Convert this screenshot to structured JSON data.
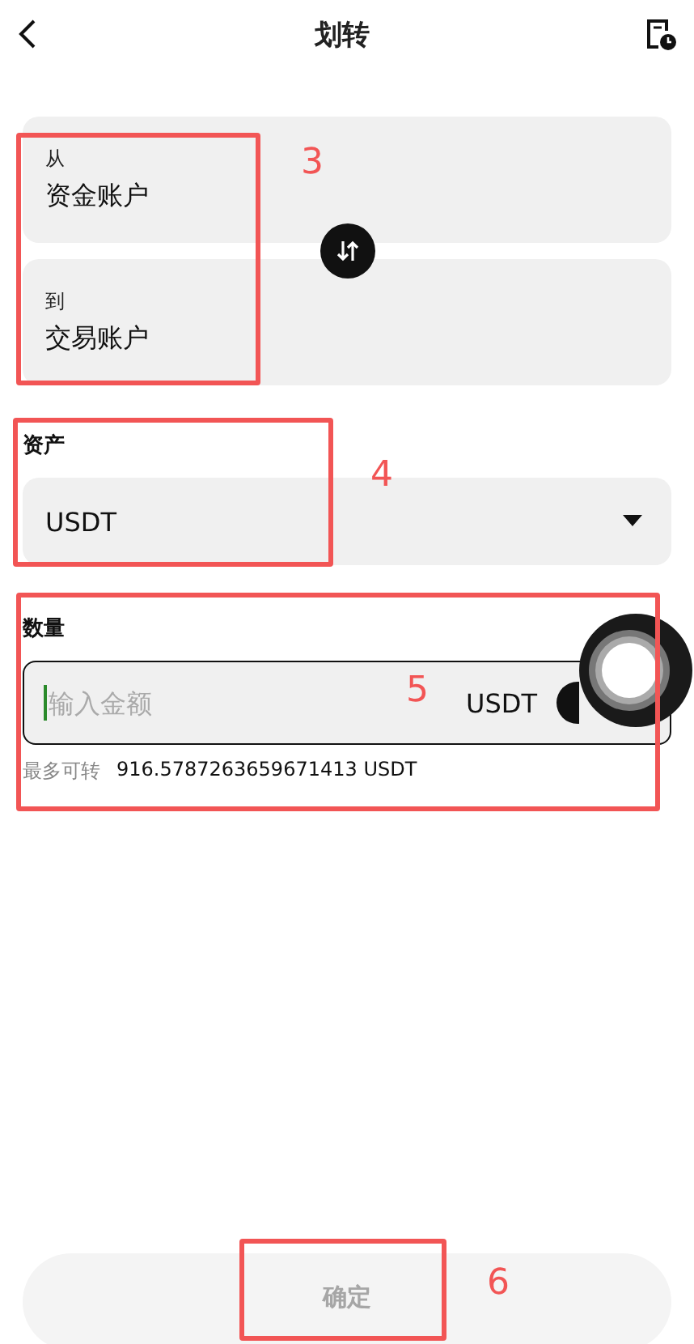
{
  "header": {
    "title": "划转"
  },
  "transfer": {
    "from": {
      "label": "从",
      "account": "资金账户"
    },
    "to": {
      "label": "到",
      "account": "交易账户"
    }
  },
  "asset": {
    "label": "资产",
    "value": "USDT"
  },
  "amount": {
    "label": "数量",
    "placeholder": "输入金额",
    "unit": "USDT",
    "max_label": "最多可转",
    "max_value": "916.5787263659671413 USDT"
  },
  "confirm": {
    "label": "确定",
    "disabled": true
  },
  "annotations": [
    {
      "label": "3"
    },
    {
      "label": "4"
    },
    {
      "label": "5"
    },
    {
      "label": "6"
    }
  ]
}
